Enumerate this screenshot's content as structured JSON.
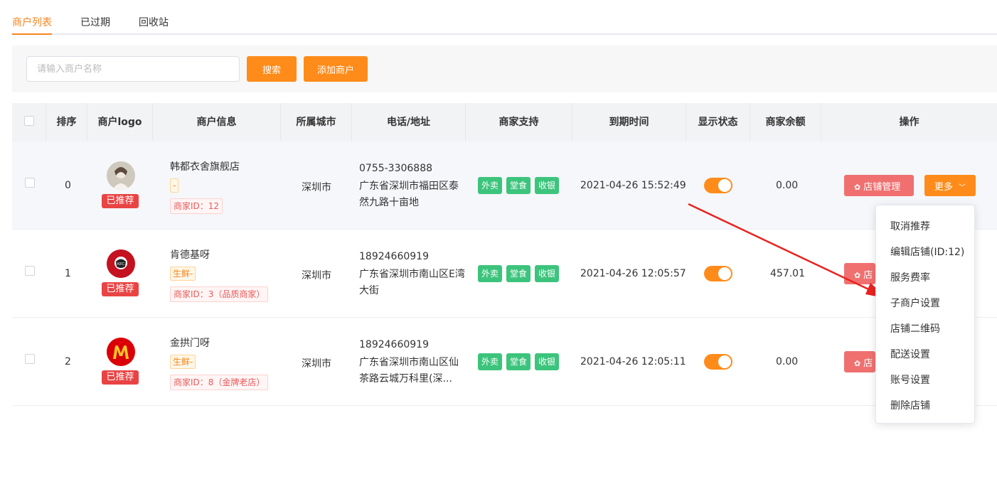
{
  "tabs": [
    {
      "label": "商户列表",
      "active": true
    },
    {
      "label": "已过期",
      "active": false
    },
    {
      "label": "回收站",
      "active": false
    }
  ],
  "toolbar": {
    "search_placeholder": "请输入商户名称",
    "search_label": "搜索",
    "add_label": "添加商户"
  },
  "table": {
    "headers": [
      "排序",
      "商户logo",
      "商户信息",
      "所属城市",
      "电话/地址",
      "商家支持",
      "到期时间",
      "显示状态",
      "商家余额",
      "操作"
    ],
    "rows": [
      {
        "sort": "0",
        "badge": "已推荐",
        "name": "韩都衣舍旗舰店",
        "category": "-",
        "merchant_id": "商家ID：12",
        "city": "深圳市",
        "phone": "0755-3306888",
        "address": "广东省深圳市福田区泰然九路十亩地",
        "support": [
          "外卖",
          "堂食",
          "收银"
        ],
        "expire": "2021-04-26 15:52:49",
        "visible": true,
        "balance": "0.00",
        "shop_btn": "店铺管理",
        "more_btn": "更多"
      },
      {
        "sort": "1",
        "badge": "已推荐",
        "name": "肯德基呀",
        "category": "生鲜-",
        "merchant_id": "商家ID：3（品质商家）",
        "city": "深圳市",
        "phone": "18924660919",
        "address": "广东省深圳市南山区E湾大街",
        "support": [
          "外卖",
          "堂食",
          "收银"
        ],
        "expire": "2021-04-26 12:05:57",
        "visible": true,
        "balance": "457.01",
        "shop_btn": "店"
      },
      {
        "sort": "2",
        "badge": "已推荐",
        "name": "金拱门呀",
        "category": "生鲜-",
        "merchant_id": "商家ID：8（金牌老店）",
        "city": "深圳市",
        "phone": "18924660919",
        "address": "广东省深圳市南山区仙茶路云城万科里(深...",
        "support": [
          "外卖",
          "堂食",
          "收银"
        ],
        "expire": "2021-04-26 12:05:11",
        "visible": true,
        "balance": "0.00",
        "shop_btn": "店"
      }
    ]
  },
  "dropdown": {
    "items": [
      "取消推荐",
      "编辑店铺(ID:12)",
      "服务费率",
      "子商户设置",
      "店铺二维码",
      "配送设置",
      "账号设置",
      "删除店铺"
    ]
  },
  "colors": {
    "accent": "#ff8c1a",
    "danger": "#e94444",
    "success": "#3cc47c",
    "annotation_arrow": "#e8231f"
  }
}
